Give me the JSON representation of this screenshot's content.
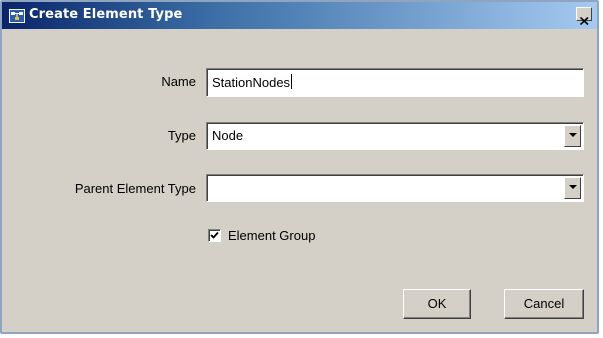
{
  "window": {
    "title": "Create Element Type",
    "title_icon": "element-type-icon",
    "close_icon": "close-icon"
  },
  "form": {
    "name_label": "Name",
    "name_value": "StationNodes",
    "type_label": "Type",
    "type_value": "Node",
    "parent_label": "Parent Element Type",
    "parent_value": "",
    "element_group_label": "Element Group",
    "element_group_checked": true
  },
  "buttons": {
    "ok_label": "OK",
    "cancel_label": "Cancel"
  },
  "colors": {
    "titlebar_start": "#0a246a",
    "titlebar_end": "#a6caf0",
    "dialog_bg": "#d4d0c8"
  }
}
